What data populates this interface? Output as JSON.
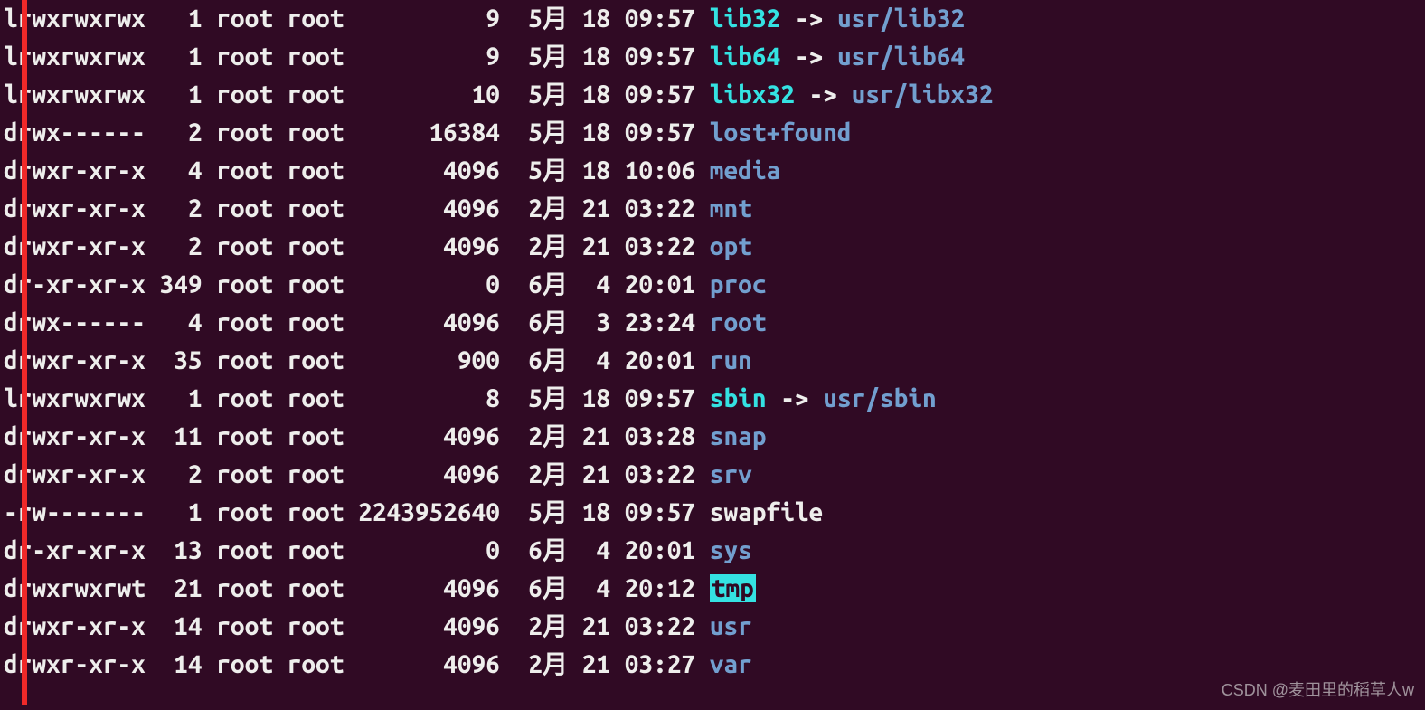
{
  "watermark": "CSDN @麦田里的稻草人w",
  "columns": {
    "perm_width": 10,
    "links_width": 4,
    "size_width": 11,
    "day_width": 3
  },
  "rows": [
    {
      "perm": "lrwxrwxrwx",
      "links": "1",
      "owner": "root",
      "group": "root",
      "size": "9",
      "month": "5月",
      "day": "18",
      "time": "09:57",
      "name": "lib32",
      "style": "link",
      "arrow": "->",
      "target": "usr/lib32",
      "target_style": "dir"
    },
    {
      "perm": "lrwxrwxrwx",
      "links": "1",
      "owner": "root",
      "group": "root",
      "size": "9",
      "month": "5月",
      "day": "18",
      "time": "09:57",
      "name": "lib64",
      "style": "link",
      "arrow": "->",
      "target": "usr/lib64",
      "target_style": "dir"
    },
    {
      "perm": "lrwxrwxrwx",
      "links": "1",
      "owner": "root",
      "group": "root",
      "size": "10",
      "month": "5月",
      "day": "18",
      "time": "09:57",
      "name": "libx32",
      "style": "link",
      "arrow": "->",
      "target": "usr/libx32",
      "target_style": "dir"
    },
    {
      "perm": "drwx------",
      "links": "2",
      "owner": "root",
      "group": "root",
      "size": "16384",
      "month": "5月",
      "day": "18",
      "time": "09:57",
      "name": "lost+found",
      "style": "dir"
    },
    {
      "perm": "drwxr-xr-x",
      "links": "4",
      "owner": "root",
      "group": "root",
      "size": "4096",
      "month": "5月",
      "day": "18",
      "time": "10:06",
      "name": "media",
      "style": "dir"
    },
    {
      "perm": "drwxr-xr-x",
      "links": "2",
      "owner": "root",
      "group": "root",
      "size": "4096",
      "month": "2月",
      "day": "21",
      "time": "03:22",
      "name": "mnt",
      "style": "dir"
    },
    {
      "perm": "drwxr-xr-x",
      "links": "2",
      "owner": "root",
      "group": "root",
      "size": "4096",
      "month": "2月",
      "day": "21",
      "time": "03:22",
      "name": "opt",
      "style": "dir"
    },
    {
      "perm": "dr-xr-xr-x",
      "links": "349",
      "owner": "root",
      "group": "root",
      "size": "0",
      "month": "6月",
      "day": "4",
      "time": "20:01",
      "name": "proc",
      "style": "dir"
    },
    {
      "perm": "drwx------",
      "links": "4",
      "owner": "root",
      "group": "root",
      "size": "4096",
      "month": "6月",
      "day": "3",
      "time": "23:24",
      "name": "root",
      "style": "dir"
    },
    {
      "perm": "drwxr-xr-x",
      "links": "35",
      "owner": "root",
      "group": "root",
      "size": "900",
      "month": "6月",
      "day": "4",
      "time": "20:01",
      "name": "run",
      "style": "dir"
    },
    {
      "perm": "lrwxrwxrwx",
      "links": "1",
      "owner": "root",
      "group": "root",
      "size": "8",
      "month": "5月",
      "day": "18",
      "time": "09:57",
      "name": "sbin",
      "style": "link",
      "arrow": "->",
      "target": "usr/sbin",
      "target_style": "dir"
    },
    {
      "perm": "drwxr-xr-x",
      "links": "11",
      "owner": "root",
      "group": "root",
      "size": "4096",
      "month": "2月",
      "day": "21",
      "time": "03:28",
      "name": "snap",
      "style": "dir"
    },
    {
      "perm": "drwxr-xr-x",
      "links": "2",
      "owner": "root",
      "group": "root",
      "size": "4096",
      "month": "2月",
      "day": "21",
      "time": "03:22",
      "name": "srv",
      "style": "dir"
    },
    {
      "perm": "-rw-------",
      "links": "1",
      "owner": "root",
      "group": "root",
      "size": "2243952640",
      "month": "5月",
      "day": "18",
      "time": "09:57",
      "name": "swapfile",
      "style": "plain"
    },
    {
      "perm": "dr-xr-xr-x",
      "links": "13",
      "owner": "root",
      "group": "root",
      "size": "0",
      "month": "6月",
      "day": "4",
      "time": "20:01",
      "name": "sys",
      "style": "dir"
    },
    {
      "perm": "drwxrwxrwt",
      "links": "21",
      "owner": "root",
      "group": "root",
      "size": "4096",
      "month": "6月",
      "day": "4",
      "time": "20:12",
      "name": "tmp",
      "style": "sticky"
    },
    {
      "perm": "drwxr-xr-x",
      "links": "14",
      "owner": "root",
      "group": "root",
      "size": "4096",
      "month": "2月",
      "day": "21",
      "time": "03:22",
      "name": "usr",
      "style": "dir"
    },
    {
      "perm": "drwxr-xr-x",
      "links": "14",
      "owner": "root",
      "group": "root",
      "size": "4096",
      "month": "2月",
      "day": "21",
      "time": "03:27",
      "name": "var",
      "style": "dir"
    }
  ]
}
